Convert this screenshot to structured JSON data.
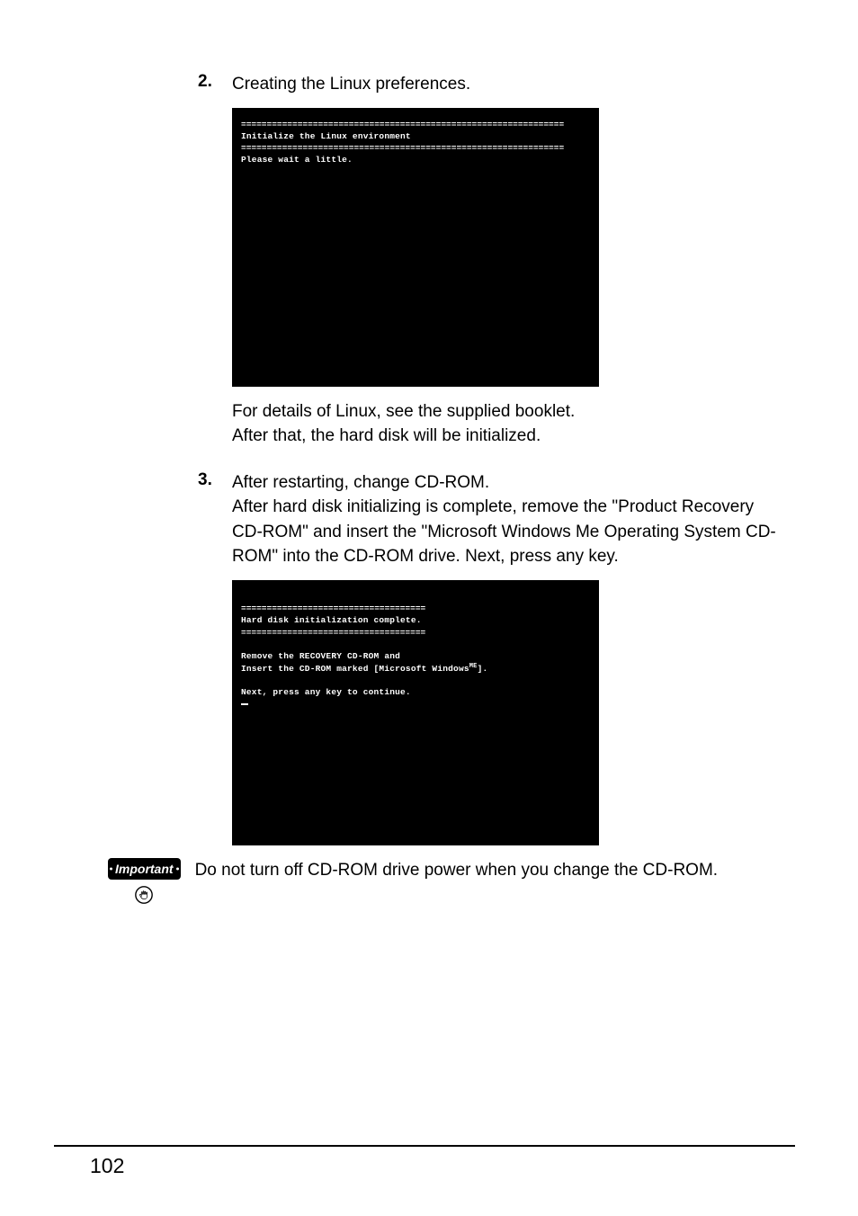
{
  "step2": {
    "number": "2.",
    "title": "Creating the Linux preferences.",
    "terminal": {
      "hr1": "===============================================================",
      "heading": "Initialize the Linux environment",
      "hr2": "===============================================================",
      "body": "Please wait a little."
    },
    "after1": "For details of Linux, see the supplied booklet.",
    "after2": "After that, the hard disk will be initialized."
  },
  "step3": {
    "number": "3.",
    "title": "After restarting, change CD-ROM.",
    "body": "After hard disk initializing is complete, remove the \"Product Recovery CD-ROM\" and insert the \"Microsoft Windows Me Operating System CD-ROM\" into the CD-ROM drive. Next, press any key.",
    "terminal": {
      "hr1": "====================================",
      "heading": "Hard disk initialization complete.",
      "hr2": "====================================",
      "line1": "Remove the RECOVERY CD-ROM and",
      "line2a": "Insert the CD-ROM marked [Microsoft Windows",
      "line2sup": "ME",
      "line2b": "].",
      "line3": "Next, press any key to continue."
    }
  },
  "important": {
    "label": "Important",
    "text": "Do not turn off CD-ROM drive power when you change the CD-ROM."
  },
  "pageNumber": "102"
}
